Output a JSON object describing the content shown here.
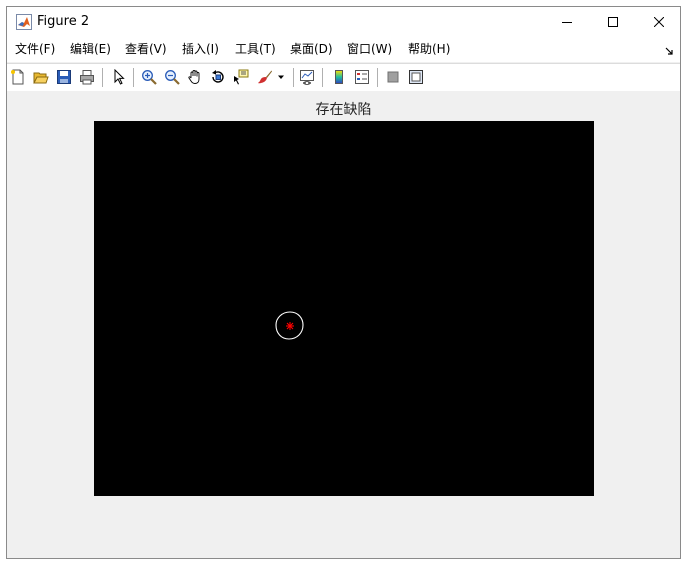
{
  "window": {
    "title": "Figure 2"
  },
  "menu": {
    "items": [
      {
        "label": "文件(F)"
      },
      {
        "label": "编辑(E)"
      },
      {
        "label": "查看(V)"
      },
      {
        "label": "插入(I)"
      },
      {
        "label": "工具(T)"
      },
      {
        "label": "桌面(D)"
      },
      {
        "label": "窗口(W)"
      },
      {
        "label": "帮助(H)"
      }
    ]
  },
  "toolbar": {
    "icons": [
      "new-figure-icon",
      "open-file-icon",
      "save-icon",
      "print-icon",
      "select-arrow-icon",
      "zoom-in-icon",
      "zoom-out-icon",
      "pan-hand-icon",
      "rotate-3d-icon",
      "data-cursor-icon",
      "brush-icon",
      "link-plot-icon",
      "colorbar-icon",
      "legend-icon",
      "hide-plot-tools-icon",
      "show-plot-tools-icon"
    ]
  },
  "plot": {
    "title": "存在缺陷",
    "background_color": "#000000",
    "contour_color": "#ffffff",
    "marker_color": "#ff0000",
    "marker": "*"
  },
  "colors": {
    "window_bg": "#f0f0f0",
    "titlebar_bg": "#ffffff"
  }
}
